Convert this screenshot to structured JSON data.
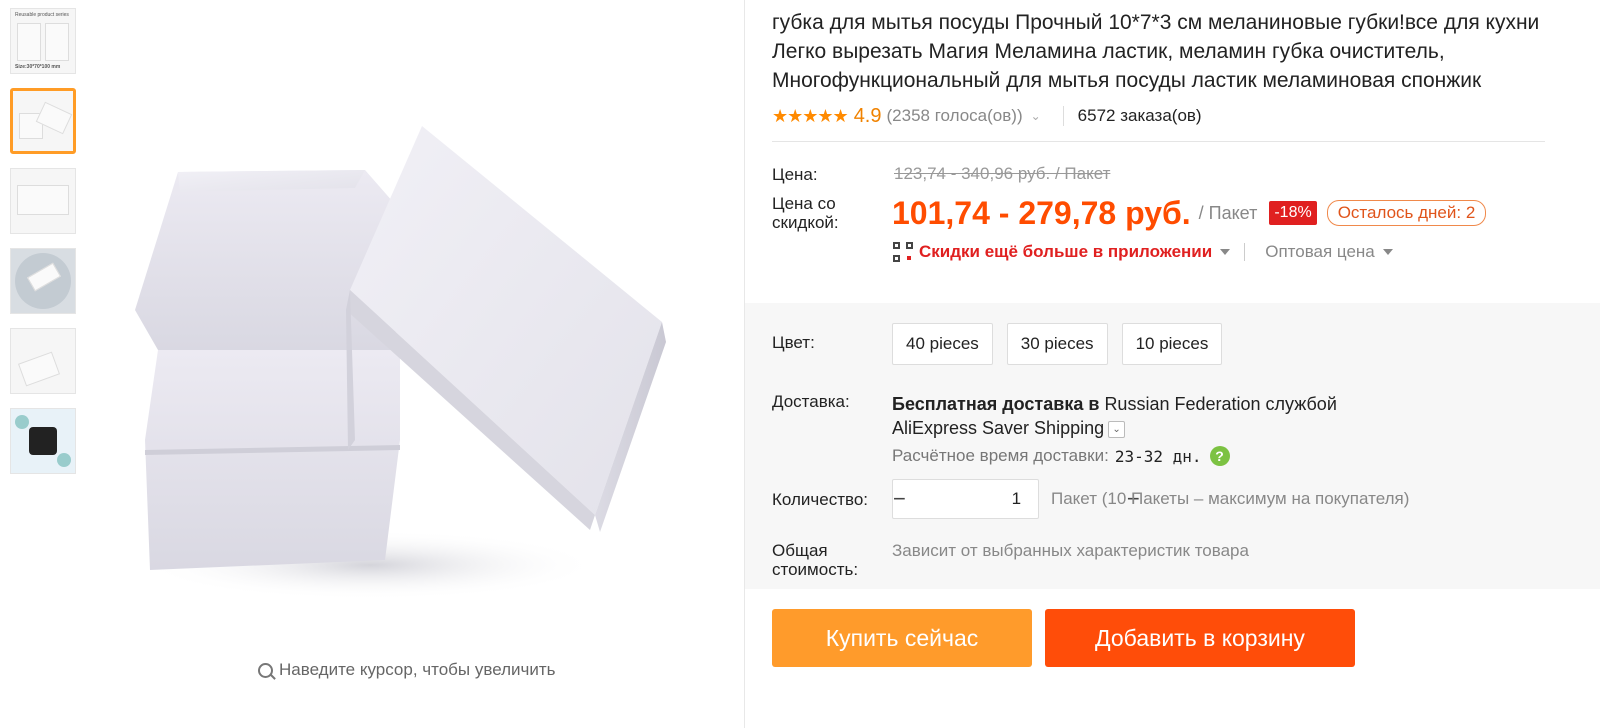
{
  "gallery": {
    "thumbnails": [
      {
        "caption_top": "Reusable product series",
        "caption_bottom": "Size:30*70*100 mm"
      },
      {
        "caption_top": "",
        "caption_bottom": ""
      },
      {
        "caption_top": "",
        "caption_bottom": ""
      },
      {
        "caption_top": "",
        "caption_bottom": ""
      },
      {
        "caption_top": "",
        "caption_bottom": ""
      },
      {
        "caption_top": "",
        "caption_bottom": ""
      }
    ],
    "active_index": 1,
    "zoom_hint": "Наведите курсор, чтобы увеличить"
  },
  "product": {
    "title": "губка для мытья посуды Прочный 10*7*3 см меланиновые губки!все для кухни Легко вырезать Магия Меламина ластик, меламин губка очиститель, Многофункциональный для мытья посуды ластик меламиновая спонжик",
    "rating": "4.9",
    "votes": "(2358 голоса(ов))",
    "orders": "6572 заказа(ов)"
  },
  "price": {
    "label": "Цена:",
    "old": "123,74 - 340,96 руб. / Пакет",
    "discount_label": "Цена со скидкой:",
    "current": "101,74 - 279,78 руб.",
    "unit": "/ Пакет",
    "discount_badge": "-18%",
    "days_left": "Осталось дней: 2",
    "app_promo": "Скидки ещё больше в приложении",
    "wholesale": "Оптовая цена"
  },
  "color": {
    "label": "Цвет:",
    "options": [
      "40 pieces",
      "30 pieces",
      "10 pieces"
    ]
  },
  "shipping": {
    "label": "Доставка:",
    "free_text": "Бесплатная доставка в",
    "country": "Russian Federation",
    "service_prefix": "службой",
    "service": "AliExpress Saver Shipping",
    "eta_label": "Расчётное время доставки:",
    "eta_value": "23-32 дн.",
    "help_symbol": "?"
  },
  "quantity": {
    "label": "Количество:",
    "value": "1",
    "minus": "−",
    "plus": "+",
    "note": "Пакет (10 Пакеты – максимум на покупателя)"
  },
  "total": {
    "label": "Общая стоимость:",
    "value": "Зависит от выбранных характеристик товара"
  },
  "buttons": {
    "buy_now": "Купить сейчас",
    "add_to_cart": "Добавить в корзину"
  },
  "colors": {
    "accent_orange": "#ff9b2b",
    "cart_orange": "#ff4d09",
    "price_red": "#ff4c00",
    "star": "#ff8a00"
  }
}
